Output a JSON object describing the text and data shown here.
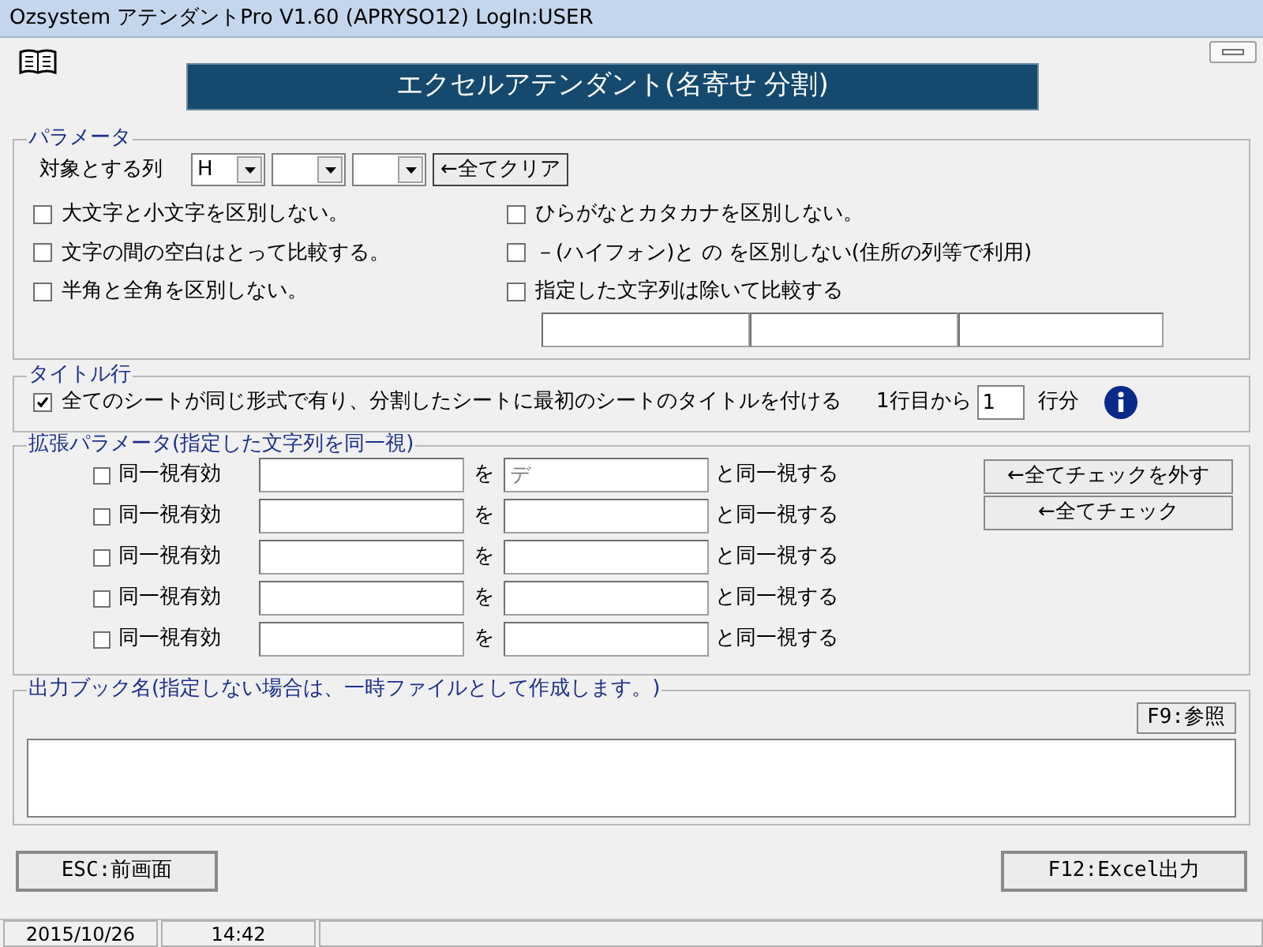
{
  "window": {
    "title": "Ozsystem アテンダントPro V1.60 (APRYSO12)  LogIn:USER"
  },
  "header": {
    "title": "エクセルアテンダント(名寄せ 分割)"
  },
  "parameters": {
    "legend": "パラメータ",
    "target_label": "対象とする列",
    "column_selects": [
      {
        "kind": "dropdown",
        "value": "H"
      },
      {
        "kind": "dropdown"
      },
      {
        "kind": "dropdown"
      }
    ],
    "clear_button": "←全てクリア",
    "options": [
      {
        "label": "大文字と小文字を区別しない。",
        "checked": false
      },
      {
        "label": "ひらがなとカタカナを区別しない。",
        "checked": false
      },
      {
        "label": "文字の間の空白はとって比較する。",
        "checked": false
      },
      {
        "label": "－(ハイフォン)と の を区別しない(住所の列等で利用)",
        "checked": false
      },
      {
        "label": "半角と全角を区別しない。",
        "checked": false
      },
      {
        "label": "指定した文字列は除いて比較する",
        "checked": false
      }
    ]
  },
  "title_row": {
    "legend": "タイトル行",
    "checkbox": {
      "label": "全てのシートが同じ形式で有り、分割したシートに最初のシートのタイトルを付ける",
      "checked": true
    },
    "from_label": "1行目から",
    "rows_value": "1",
    "unit": "行分"
  },
  "extended": {
    "legend": "拡張パラメータ(指定した文字列を同一視)",
    "rows": [
      {
        "label": "同一視有効",
        "checked": false,
        "particle": "を",
        "target": "デ",
        "suffix": "と同一視する"
      },
      {
        "label": "同一視有効",
        "checked": false,
        "particle": "を",
        "suffix": "と同一視する"
      },
      {
        "label": "同一視有効",
        "checked": false,
        "particle": "を",
        "suffix": "と同一視する"
      },
      {
        "label": "同一視有効",
        "checked": false,
        "particle": "を",
        "suffix": "と同一視する"
      },
      {
        "label": "同一視有効",
        "checked": false,
        "particle": "を",
        "suffix": "と同一視する"
      }
    ],
    "buttons": [
      "←全てチェックを外す",
      "←全てチェック"
    ]
  },
  "output": {
    "legend": "出力ブック名(指定しない場合は、一時ファイルとして作成します。)",
    "browse_button": "F9:参照"
  },
  "footer": {
    "back_button": "ESC:前画面",
    "export_button": "F12:Excel出力"
  },
  "status_bar": [
    "2015/10/26",
    "14:42"
  ]
}
